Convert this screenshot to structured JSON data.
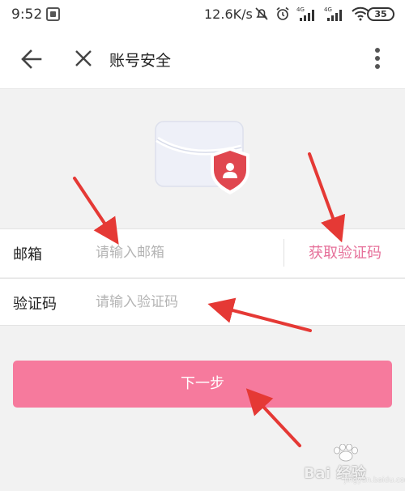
{
  "status_bar": {
    "time": "9:52",
    "net_speed": "12.6K/s",
    "battery": "35",
    "signal_label": "4G"
  },
  "app_bar": {
    "title": "账号安全"
  },
  "form": {
    "email_label": "邮箱",
    "email_placeholder": "请输入邮箱",
    "get_code_label": "获取验证码",
    "code_label": "验证码",
    "code_placeholder": "请输入验证码"
  },
  "actions": {
    "next_label": "下一步"
  },
  "watermark": {
    "brand_text": "Bai 经验",
    "url_text": "jingyan.baidu.com"
  },
  "colors": {
    "accent": "#e6709a",
    "button": "#f67a9d",
    "shield": "#e0474f",
    "arrow": "#e53935"
  }
}
